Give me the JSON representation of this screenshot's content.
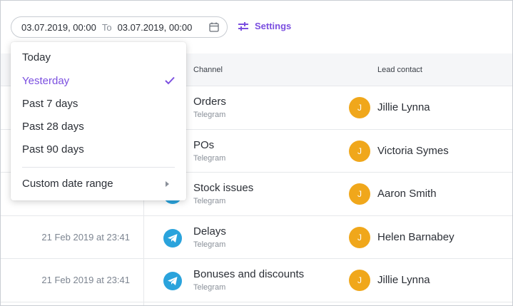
{
  "date_range": {
    "from": "03.07.2019, 00:00",
    "separator": "To",
    "to": "03.07.2019, 00:00"
  },
  "settings_label": "Settings",
  "table": {
    "headers": {
      "channel": "Channel",
      "lead_contact": "Lead contact"
    },
    "rows": [
      {
        "date": "",
        "channel": "Orders",
        "source": "Telegram",
        "avatar": "J",
        "lead": "Jillie Lynna"
      },
      {
        "date": "",
        "channel": "POs",
        "source": "Telegram",
        "avatar": "J",
        "lead": "Victoria Symes"
      },
      {
        "date": "",
        "channel": "Stock issues",
        "source": "Telegram",
        "avatar": "J",
        "lead": "Aaron Smith"
      },
      {
        "date": "21 Feb 2019 at 23:41",
        "channel": "Delays",
        "source": "Telegram",
        "avatar": "J",
        "lead": "Helen Barnabey"
      },
      {
        "date": "21 Feb 2019 at 23:41",
        "channel": "Bonuses and discounts",
        "source": "Telegram",
        "avatar": "J",
        "lead": "Jillie Lynna"
      }
    ]
  },
  "dropdown": {
    "items": [
      "Today",
      "Yesterday",
      "Past 7 days",
      "Past 28 days",
      "Past 90 days"
    ],
    "selected": "Yesterday",
    "custom_label": "Custom date range"
  },
  "colors": {
    "accent": "#7b4fe0",
    "avatar": "#f0a71b",
    "telegram": "#2aa3dc"
  },
  "icons": {
    "calendar": "calendar-icon",
    "settings": "sliders-icon",
    "check": "check-icon",
    "telegram": "telegram-icon",
    "submenu": "chevron-right-icon"
  }
}
